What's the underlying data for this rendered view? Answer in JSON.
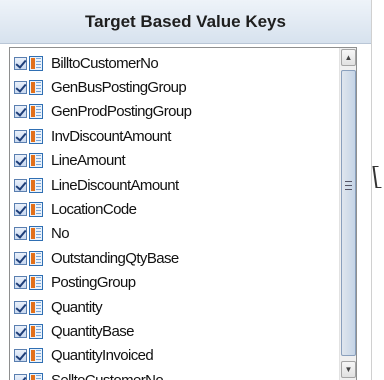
{
  "panel": {
    "title": "Target Based Value Keys"
  },
  "fields": [
    {
      "label": "BilltoCustomerNo",
      "checked": true
    },
    {
      "label": "GenBusPostingGroup",
      "checked": true
    },
    {
      "label": "GenProdPostingGroup",
      "checked": true
    },
    {
      "label": "InvDiscountAmount",
      "checked": true
    },
    {
      "label": "LineAmount",
      "checked": true
    },
    {
      "label": "LineDiscountAmount",
      "checked": true
    },
    {
      "label": "LocationCode",
      "checked": true
    },
    {
      "label": "No",
      "checked": true
    },
    {
      "label": "OutstandingQtyBase",
      "checked": true
    },
    {
      "label": "PostingGroup",
      "checked": true
    },
    {
      "label": "Quantity",
      "checked": true
    },
    {
      "label": "QuantityBase",
      "checked": true
    },
    {
      "label": "QuantityInvoiced",
      "checked": true
    },
    {
      "label": "SelltoCustomerNo",
      "checked": true
    }
  ],
  "icons": {
    "checkbox": "checkbox-checked-icon",
    "field": "table-field-icon",
    "scroll_up": "chevron-up-icon",
    "scroll_down": "chevron-down-icon"
  },
  "colors": {
    "header_bg": "#d7e2ee",
    "field_icon_accent": "#e2701a",
    "checkbox_border": "#5a7fb0"
  }
}
